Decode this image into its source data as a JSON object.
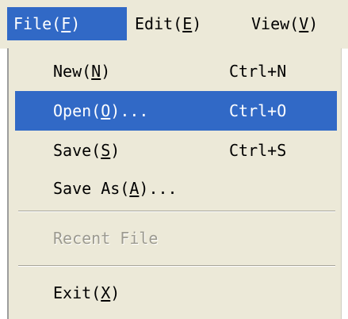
{
  "menubar": {
    "items": [
      {
        "label": "File",
        "accel": "F",
        "selected": true
      },
      {
        "label": "Edit",
        "accel": "E",
        "selected": false
      },
      {
        "label": "View",
        "accel": "V",
        "selected": false
      }
    ]
  },
  "file_menu": {
    "items": [
      {
        "label": "New",
        "accel": "N",
        "suffix": "",
        "shortcut": "Ctrl+N"
      },
      {
        "label": "Open",
        "accel": "O",
        "suffix": "...",
        "shortcut": "Ctrl+O",
        "highlighted": true
      },
      {
        "label": "Save",
        "accel": "S",
        "suffix": "",
        "shortcut": "Ctrl+S"
      },
      {
        "label": "Save As",
        "accel": "A",
        "suffix": "...",
        "shortcut": ""
      },
      {
        "label": "Recent File",
        "disabled": true
      },
      {
        "label": "Exit",
        "accel": "X",
        "suffix": ""
      }
    ]
  },
  "colors": {
    "menu_background": "#ece9d8",
    "highlight": "#3169c6",
    "highlight_text": "#ffffff",
    "disabled_text": "#9c9a8f"
  }
}
